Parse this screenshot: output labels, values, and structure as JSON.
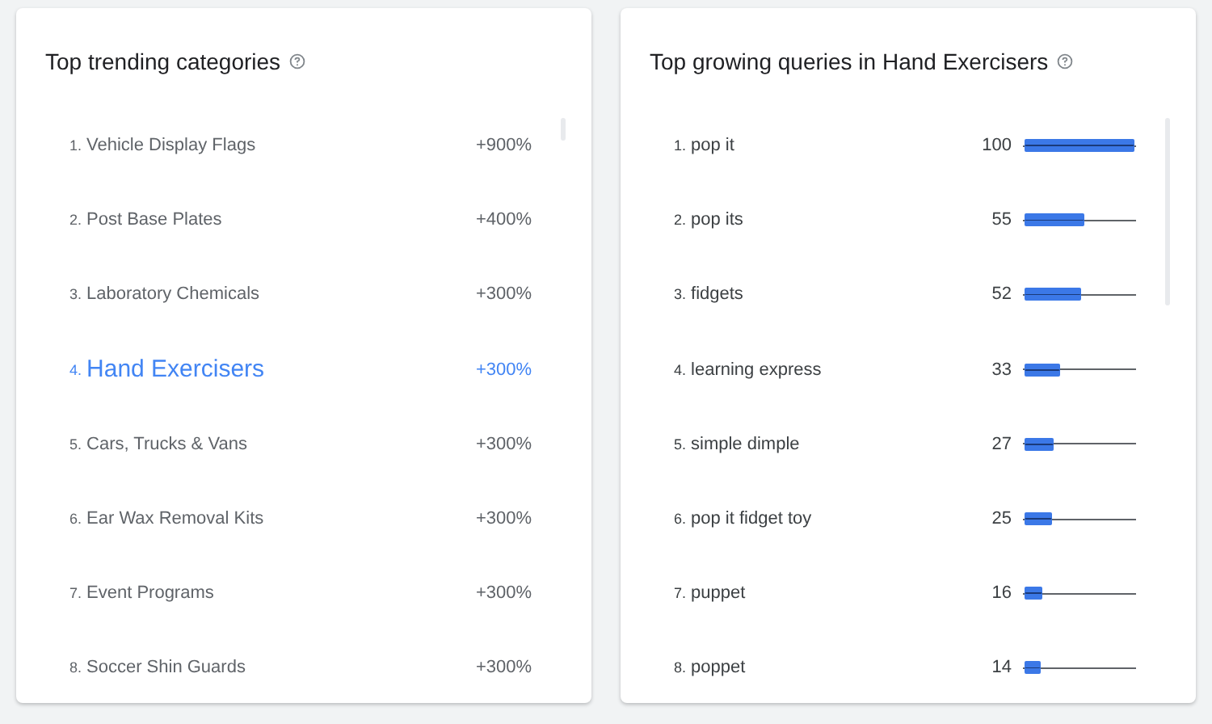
{
  "categories_panel": {
    "title": "Top trending categories",
    "items": [
      {
        "rank": "1.",
        "label": "Vehicle Display Flags",
        "change": "+900%",
        "selected": false
      },
      {
        "rank": "2.",
        "label": "Post Base Plates",
        "change": "+400%",
        "selected": false
      },
      {
        "rank": "3.",
        "label": "Laboratory Chemicals",
        "change": "+300%",
        "selected": false
      },
      {
        "rank": "4.",
        "label": "Hand Exercisers",
        "change": "+300%",
        "selected": true
      },
      {
        "rank": "5.",
        "label": "Cars, Trucks & Vans",
        "change": "+300%",
        "selected": false
      },
      {
        "rank": "6.",
        "label": "Ear Wax Removal Kits",
        "change": "+300%",
        "selected": false
      },
      {
        "rank": "7.",
        "label": "Event Programs",
        "change": "+300%",
        "selected": false
      },
      {
        "rank": "8.",
        "label": "Soccer Shin Guards",
        "change": "+300%",
        "selected": false
      }
    ]
  },
  "queries_panel": {
    "title": "Top growing queries in Hand Exercisers",
    "items": [
      {
        "rank": "1.",
        "label": "pop it",
        "value": "100",
        "level": 1.0
      },
      {
        "rank": "2.",
        "label": "pop its",
        "value": "55",
        "level": 0.55
      },
      {
        "rank": "3.",
        "label": "fidgets",
        "value": "52",
        "level": 0.52
      },
      {
        "rank": "4.",
        "label": "learning express",
        "value": "33",
        "level": 0.33
      },
      {
        "rank": "5.",
        "label": "simple dimple",
        "value": "27",
        "level": 0.27
      },
      {
        "rank": "6.",
        "label": "pop it fidget toy",
        "value": "25",
        "level": 0.25
      },
      {
        "rank": "7.",
        "label": "puppet",
        "value": "16",
        "level": 0.16
      },
      {
        "rank": "8.",
        "label": "poppet",
        "value": "14",
        "level": 0.14
      }
    ]
  }
}
